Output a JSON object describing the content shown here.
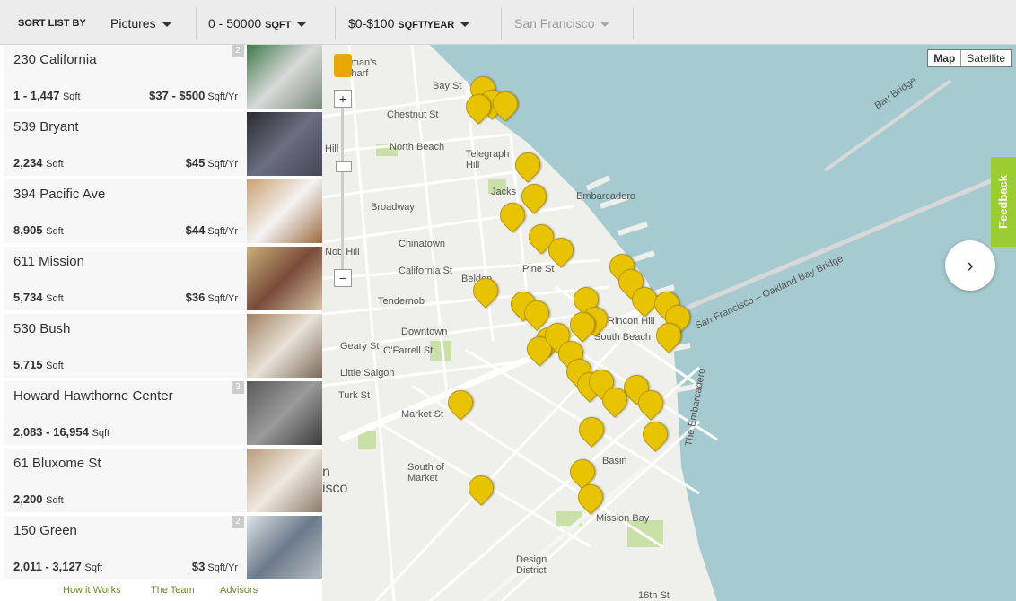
{
  "filters": {
    "sort_label": "SORT LIST BY",
    "sort_value": "Pictures",
    "size_value": "0 - 50000",
    "size_unit": "SQFT",
    "price_value": "$0-$100",
    "price_unit": "SQFT/YEAR",
    "city": "San Francisco"
  },
  "listings": [
    {
      "name": "230 California",
      "sqft": "1 - 1,447",
      "sqft_unit": "Sqft",
      "price": "$37 - $500",
      "price_unit": "Sqft/Yr",
      "count": "2"
    },
    {
      "name": "539 Bryant",
      "sqft": "2,234",
      "sqft_unit": "Sqft",
      "price": "$45",
      "price_unit": "Sqft/Yr",
      "count": ""
    },
    {
      "name": "394 Pacific Ave",
      "sqft": "8,905",
      "sqft_unit": "Sqft",
      "price": "$44",
      "price_unit": "Sqft/Yr",
      "count": ""
    },
    {
      "name": "611 Mission",
      "sqft": "5,734",
      "sqft_unit": "Sqft",
      "price": "$36",
      "price_unit": "Sqft/Yr",
      "count": ""
    },
    {
      "name": "530 Bush",
      "sqft": "5,715",
      "sqft_unit": "Sqft",
      "price": "",
      "price_unit": "",
      "count": ""
    },
    {
      "name": "Howard Hawthorne Center",
      "sqft": "2,083 - 16,954",
      "sqft_unit": "Sqft",
      "price": "",
      "price_unit": "",
      "count": "3"
    },
    {
      "name": "61 Bluxome St",
      "sqft": "2,200",
      "sqft_unit": "Sqft",
      "price": "",
      "price_unit": "",
      "count": ""
    },
    {
      "name": "150 Green",
      "sqft": "2,011 - 3,127",
      "sqft_unit": "Sqft",
      "price": "$3",
      "price_unit": "Sqft/Yr",
      "count": "2"
    }
  ],
  "footer": {
    "how": "How it Works",
    "team": "The Team",
    "advisors": "Advisors"
  },
  "map": {
    "map_btn": "Map",
    "satellite_btn": "Satellite",
    "feedback": "Feedback",
    "next_icon": "›",
    "zoom_in": "+",
    "zoom_out": "−",
    "labels": {
      "fishermans_wharf": "erman's\nWharf",
      "bay_st": "Bay St",
      "chestnut_st": "Chestnut St",
      "north_beach": "North Beach",
      "telegraph_hill": "Telegraph\nHill",
      "broadway": "Broadway",
      "jackson": "Jacks",
      "embarcadero": "Embarcadero",
      "chinatown": "Chinatown",
      "nob_hill": "Nob Hill",
      "california_st": "California St",
      "tendernob": "Tendernob",
      "pine_st": "Pine St",
      "belden": "Belden",
      "rincon_hill": "Rincon Hill",
      "south_beach": "South Beach",
      "downtown": "Downtown",
      "geary_st": "Geary St",
      "ofarrell_st": "O'Farrell St",
      "little_saigon": "Little Saigon",
      "turk_st": "Turk St",
      "market_st": "Market St",
      "south_of_market": "South of\nMarket",
      "mission_bay": "Mission Bay",
      "design_district": "Design\nDistrict",
      "bay_bridge": "Bay Bridge",
      "oakland_bay_bridge": "San Francisco – Oakland Bay Bridge",
      "the_embarcadero": "The Embarcadero",
      "basin": "Basin",
      "hill": "Hill",
      "sf_partial": "n\nisco",
      "st16": "16th St"
    }
  },
  "colors": {
    "pin": "#e8c400",
    "water": "#a5cbd1",
    "land": "#efefeb",
    "park": "#c9e0a6",
    "feedback": "#9acd32",
    "footer_link": "#6b8e23"
  }
}
